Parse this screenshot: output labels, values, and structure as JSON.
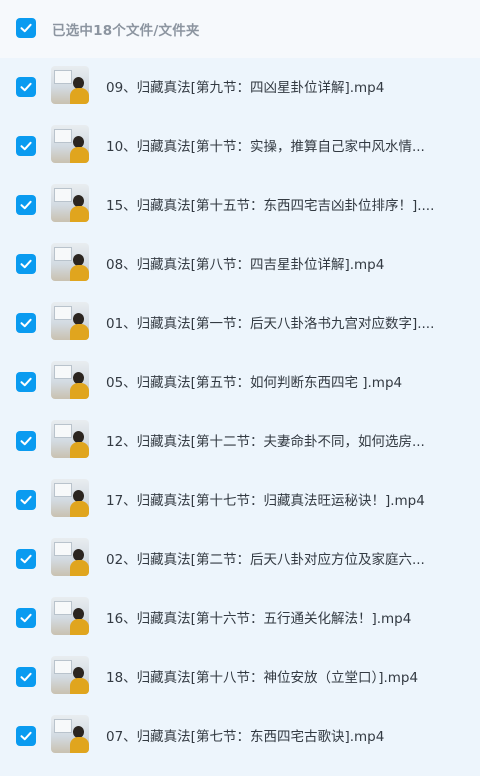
{
  "header": {
    "title": "已选中18个文件/文件夹"
  },
  "colors": {
    "accent": "#0a9bf0",
    "background": "#edf5fc",
    "title": "#8c95a0",
    "text": "#333a42"
  },
  "icons": {
    "checkbox": "check-icon",
    "thumbnail": "video-thumbnail"
  },
  "files": [
    {
      "name": "09、归藏真法[第九节：四凶星卦位详解].mp4"
    },
    {
      "name": "10、归藏真法[第十节：实操，推算自己家中风水情..."
    },
    {
      "name": "15、归藏真法[第十五节：东西四宅吉凶卦位排序！]...."
    },
    {
      "name": "08、归藏真法[第八节：四吉星卦位详解].mp4"
    },
    {
      "name": "01、归藏真法[第一节：后天八卦洛书九宫对应数字]...."
    },
    {
      "name": "05、归藏真法[第五节：如何判断东西四宅 ].mp4"
    },
    {
      "name": "12、归藏真法[第十二节：夫妻命卦不同，如何选房..."
    },
    {
      "name": "17、归藏真法[第十七节：归藏真法旺运秘诀！].mp4"
    },
    {
      "name": "02、归藏真法[第二节：后天八卦对应方位及家庭六..."
    },
    {
      "name": "16、归藏真法[第十六节：五行通关化解法！].mp4"
    },
    {
      "name": "18、归藏真法[第十八节：神位安放（立堂口）].mp4"
    },
    {
      "name": "07、归藏真法[第七节：东西四宅古歌诀].mp4"
    }
  ]
}
